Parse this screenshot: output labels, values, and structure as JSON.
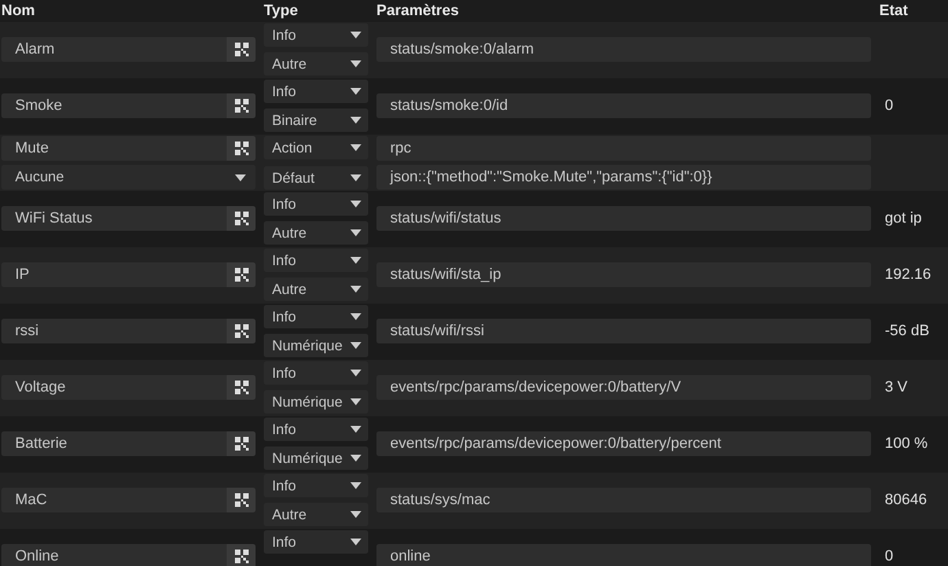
{
  "columns": [
    "Nom",
    "Type",
    "Paramètres",
    "Etat"
  ],
  "rows": [
    {
      "name": "Alarm",
      "types": [
        "Info",
        "Autre"
      ],
      "params": [
        "status/smoke:0/alarm"
      ]
    },
    {
      "name": "Smoke",
      "types": [
        "Info",
        "Binaire"
      ],
      "params": [
        "status/smoke:0/id"
      ],
      "state": "0"
    },
    {
      "name": "Mute",
      "option": "Aucune",
      "types": [
        "Action",
        "Défaut"
      ],
      "params": [
        "rpc",
        "json::{\"method\":\"Smoke.Mute\",\"params\":{\"id\":0}}"
      ]
    },
    {
      "name": "WiFi Status",
      "types": [
        "Info",
        "Autre"
      ],
      "params": [
        "status/wifi/status"
      ],
      "state": "got ip"
    },
    {
      "name": "IP",
      "types": [
        "Info",
        "Autre"
      ],
      "params": [
        "status/wifi/sta_ip"
      ],
      "state": "192.16"
    },
    {
      "name": "rssi",
      "types": [
        "Info",
        "Numérique"
      ],
      "params": [
        "status/wifi/rssi"
      ],
      "state": "-56 dB"
    },
    {
      "name": "Voltage",
      "types": [
        "Info",
        "Numérique"
      ],
      "params": [
        "events/rpc/params/devicepower:0/battery/V"
      ],
      "state": "3 V"
    },
    {
      "name": "Batterie",
      "types": [
        "Info",
        "Numérique"
      ],
      "params": [
        "events/rpc/params/devicepower:0/battery/percent"
      ],
      "state": "100 %"
    },
    {
      "name": "MaC",
      "types": [
        "Info",
        "Autre"
      ],
      "params": [
        "status/sys/mac"
      ],
      "state": "80646"
    },
    {
      "name": "Online",
      "types": [
        "Info"
      ],
      "params": [
        "online"
      ],
      "state": "0"
    }
  ]
}
